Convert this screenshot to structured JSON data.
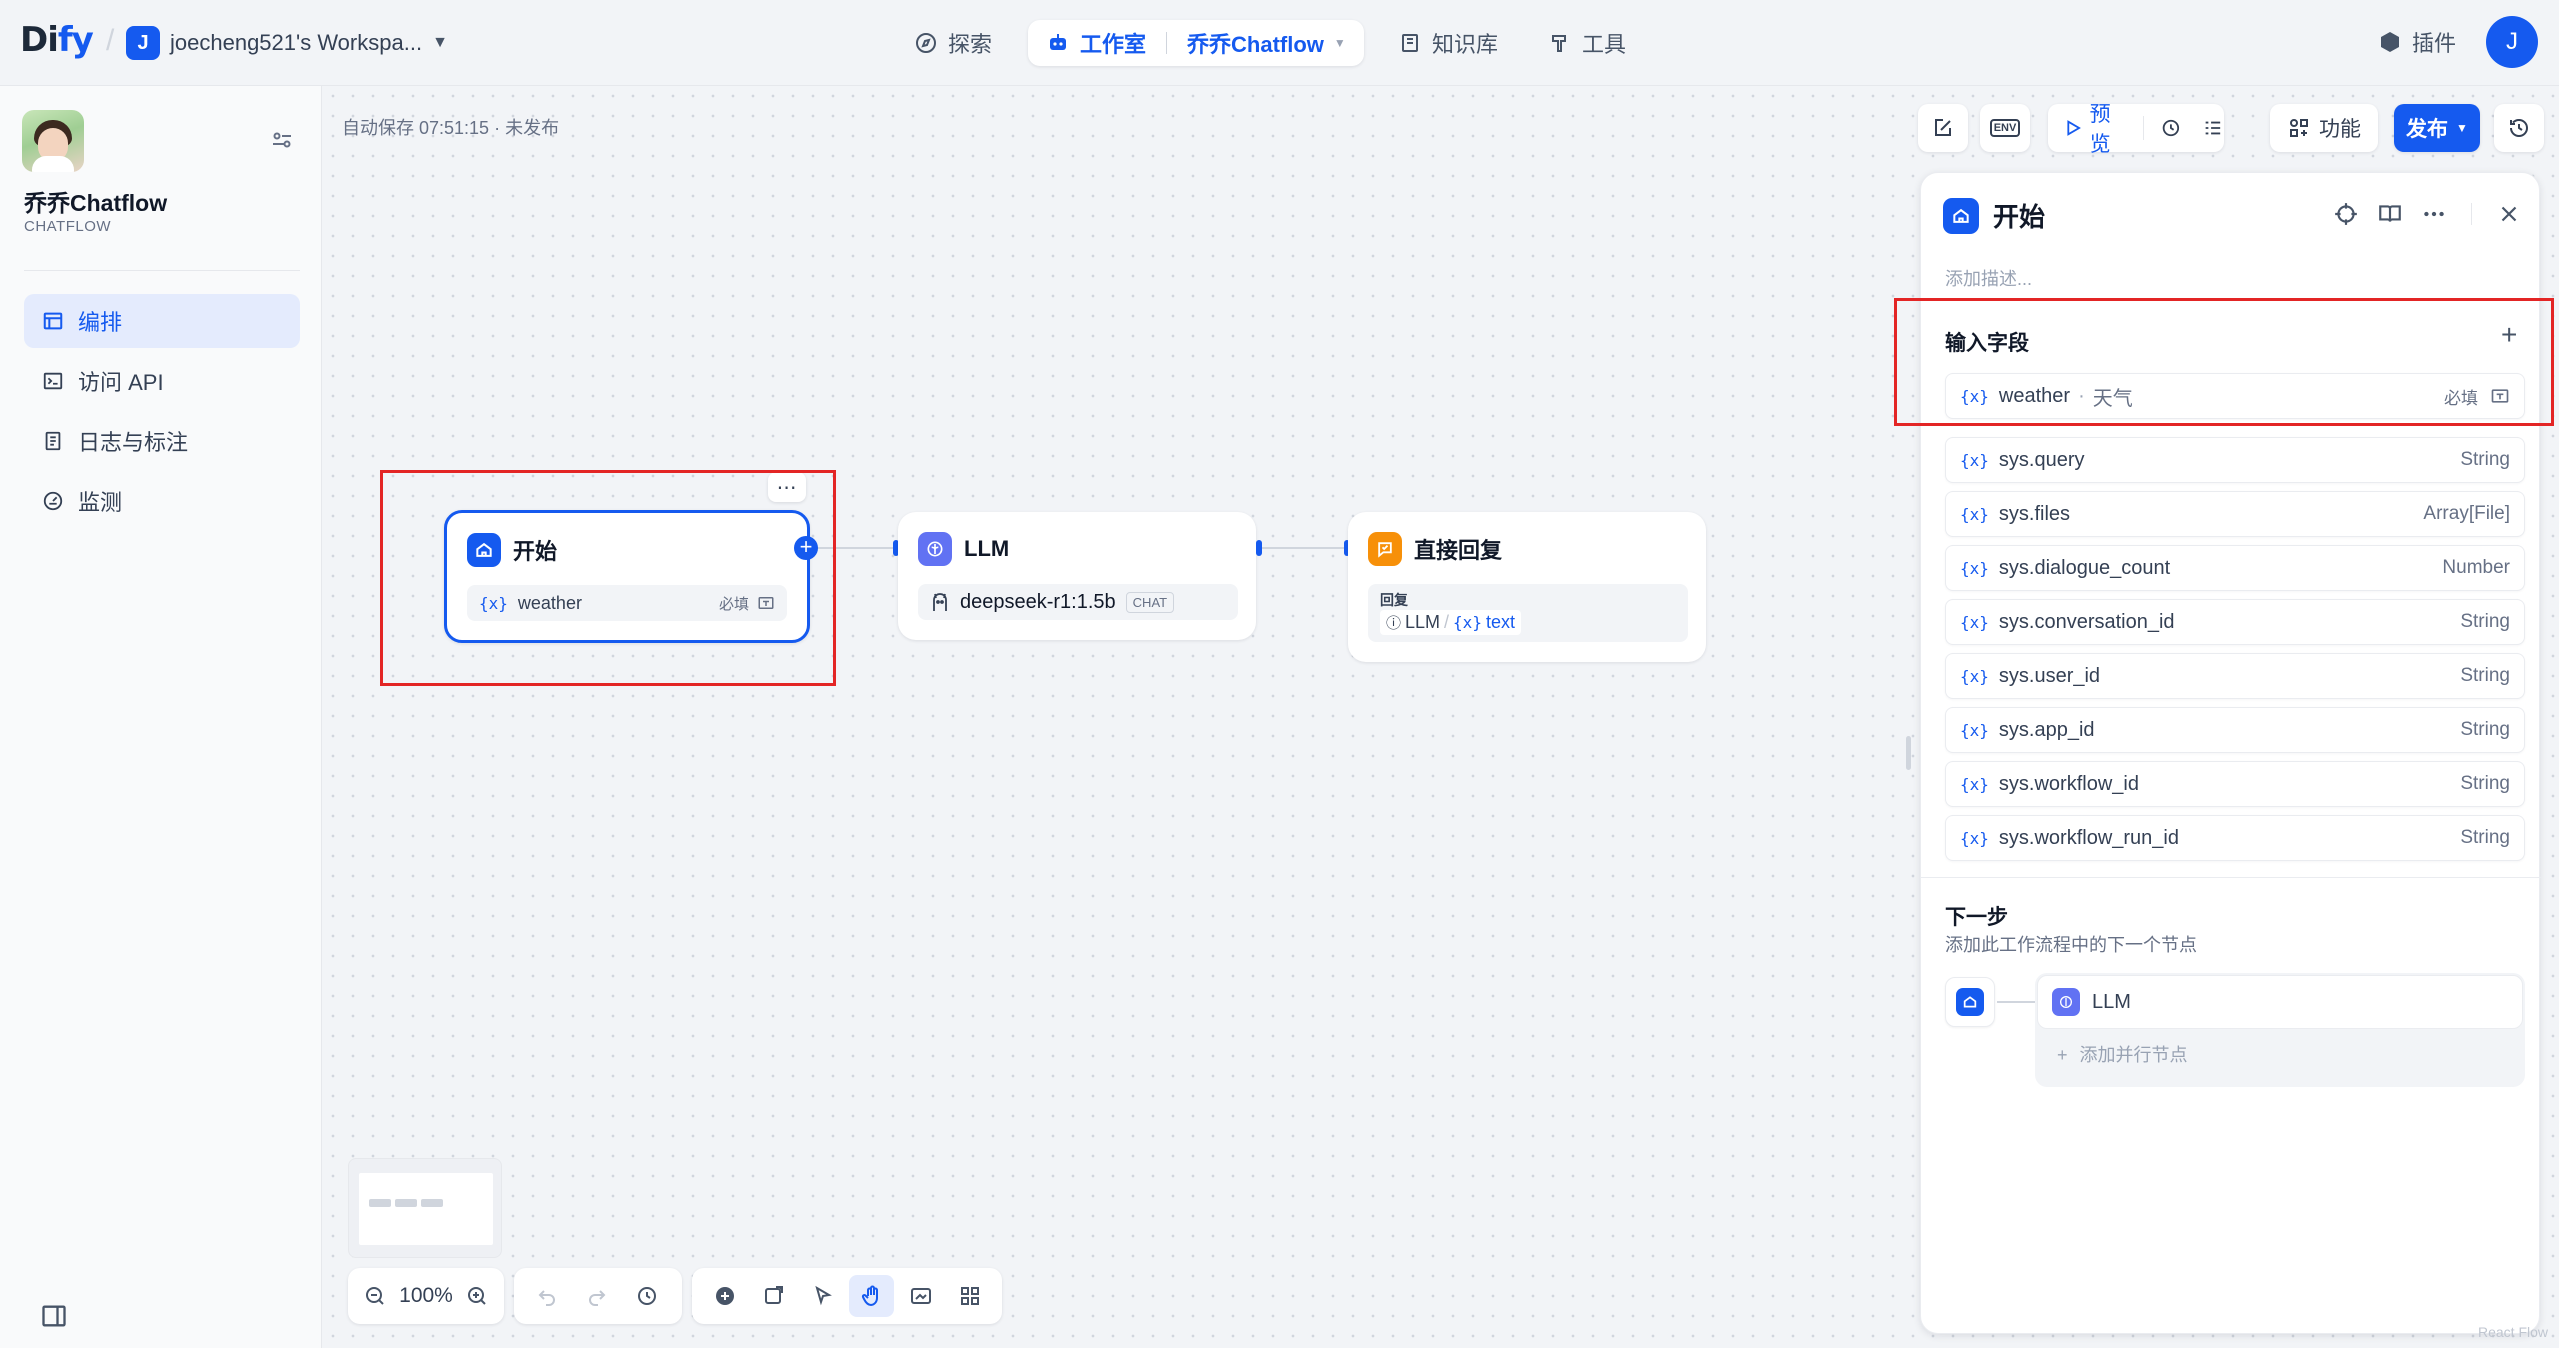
{
  "header": {
    "logo_main": "Di",
    "logo_accent": "fy",
    "workspace_initial": "J",
    "workspace_name": "joecheng521's Workspa...",
    "nav": {
      "explore": "探索",
      "studio": "工作室",
      "app_name": "乔乔Chatflow",
      "knowledge": "知识库",
      "tools": "工具"
    },
    "plugins": "插件",
    "user_initial": "J"
  },
  "sidebar": {
    "app_name": "乔乔Chatflow",
    "app_type": "CHATFLOW",
    "items": [
      {
        "label": "编排",
        "icon": "layout-icon",
        "active": true
      },
      {
        "label": "访问 API",
        "icon": "terminal-icon",
        "active": false
      },
      {
        "label": "日志与标注",
        "icon": "file-list-icon",
        "active": false
      },
      {
        "label": "监测",
        "icon": "dashboard-icon",
        "active": false
      }
    ]
  },
  "canvas": {
    "autosave": "自动保存 07:51:15 · 未发布",
    "zoom": "100%",
    "nodes": {
      "start": {
        "title": "开始",
        "variable": "weather",
        "required": "必填",
        "color": "#155aef"
      },
      "llm": {
        "title": "LLM",
        "model": "deepseek-r1:1.5b",
        "mode": "CHAT",
        "color": "#6172f3"
      },
      "answer": {
        "title": "直接回复",
        "label": "回复",
        "source_node": "LLM",
        "source_var": "text",
        "color": "#f79009"
      }
    }
  },
  "toolbar": {
    "preview": "预览",
    "features": "功能",
    "publish": "发布",
    "env": "ENV"
  },
  "panel": {
    "title": "开始",
    "description_placeholder": "添加描述...",
    "input_fields_title": "输入字段",
    "user_field": {
      "name": "weather",
      "label": "天气",
      "required": "必填"
    },
    "system_fields": [
      {
        "name": "sys.query",
        "type": "String"
      },
      {
        "name": "sys.files",
        "type": "Array[File]"
      },
      {
        "name": "sys.dialogue_count",
        "type": "Number"
      },
      {
        "name": "sys.conversation_id",
        "type": "String"
      },
      {
        "name": "sys.user_id",
        "type": "String"
      },
      {
        "name": "sys.app_id",
        "type": "String"
      },
      {
        "name": "sys.workflow_id",
        "type": "String"
      },
      {
        "name": "sys.workflow_run_id",
        "type": "String"
      }
    ],
    "next_step_title": "下一步",
    "next_step_sub": "添加此工作流程中的下一个节点",
    "next_node": "LLM",
    "add_parallel": "添加并行节点"
  },
  "colors": {
    "accent": "#155aef",
    "highlight_box": "#e32525"
  },
  "var_symbol": "{x}",
  "watermark": "React Flow"
}
